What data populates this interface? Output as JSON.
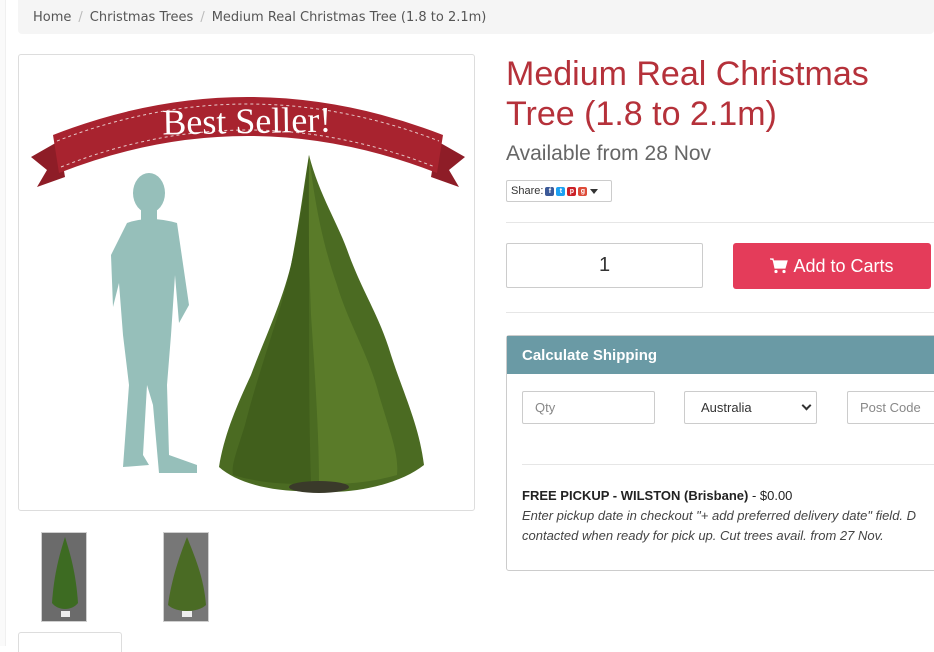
{
  "breadcrumb": {
    "home": "Home",
    "category": "Christmas Trees",
    "current": "Medium Real Christmas Tree (1.8 to 2.1m)",
    "separator": "/"
  },
  "main_image": {
    "banner_text": "Best Seller!",
    "banner_color": "#a8232f",
    "silhouette_color": "#96bfba",
    "tree_color": "#4b6b22"
  },
  "product": {
    "title": "Medium Real Christmas Tree (1.8 to 2.1m)",
    "availability": "Available from 28 Nov"
  },
  "share": {
    "label": "Share:",
    "icons": [
      "facebook-icon",
      "twitter-icon",
      "pinterest-icon",
      "google-plus-icon"
    ]
  },
  "cart": {
    "quantity": "1",
    "add_label": "Add to Carts",
    "button_color": "#e43c5a"
  },
  "shipping": {
    "title": "Calculate Shipping",
    "header_color": "#6a9aa5",
    "qty_placeholder": "Qty",
    "country": "Australia",
    "postcode_placeholder": "Post Code",
    "option_name": "FREE PICKUP - WILSTON (Brisbane)",
    "option_price": " - $0.00",
    "option_note": "Enter pickup date in checkout \"+ add preferred delivery date\" field. D contacted when ready for pick up. Cut trees avail. from 27 Nov."
  }
}
